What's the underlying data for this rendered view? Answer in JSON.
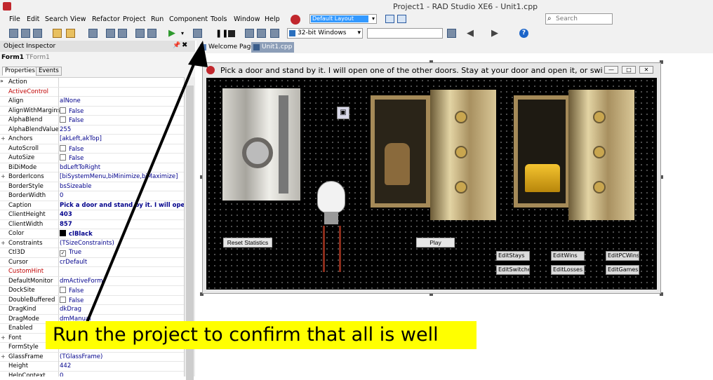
{
  "window": {
    "title": "Project1 - RAD Studio XE6 - Unit1.cpp"
  },
  "menu": [
    "File",
    "Edit",
    "Search",
    "View",
    "Refactor",
    "Project",
    "Run",
    "Component",
    "Tools",
    "Window",
    "Help"
  ],
  "layout_combo": {
    "value": "Default Layout"
  },
  "search": {
    "placeholder": "Search"
  },
  "toolbar": {
    "platform": "32-bit Windows",
    "configuration": ""
  },
  "object_inspector": {
    "title": "Object Inspector",
    "object_name": "Form1",
    "object_type": "TForm1",
    "tabs": [
      "Properties",
      "Events"
    ],
    "properties": [
      {
        "name": "Action",
        "value": "",
        "expand": "",
        "style": ""
      },
      {
        "name": "ActiveControl",
        "value": "",
        "expand": "",
        "style": "red"
      },
      {
        "name": "Align",
        "value": "alNone",
        "expand": "",
        "style": ""
      },
      {
        "name": "AlignWithMargins",
        "value": "False",
        "expand": "",
        "style": "",
        "checkbox": "unchecked"
      },
      {
        "name": "AlphaBlend",
        "value": "False",
        "expand": "",
        "style": "",
        "checkbox": "unchecked"
      },
      {
        "name": "AlphaBlendValue",
        "value": "255",
        "expand": "",
        "style": ""
      },
      {
        "name": "Anchors",
        "value": "[akLeft,akTop]",
        "expand": "+",
        "style": ""
      },
      {
        "name": "AutoScroll",
        "value": "False",
        "expand": "",
        "style": "",
        "checkbox": "unchecked"
      },
      {
        "name": "AutoSize",
        "value": "False",
        "expand": "",
        "style": "",
        "checkbox": "unchecked"
      },
      {
        "name": "BiDiMode",
        "value": "bdLeftToRight",
        "expand": "",
        "style": ""
      },
      {
        "name": "BorderIcons",
        "value": "[biSystemMenu,biMinimize,biMaximize]",
        "expand": "+",
        "style": ""
      },
      {
        "name": "BorderStyle",
        "value": "bsSizeable",
        "expand": "",
        "style": ""
      },
      {
        "name": "BorderWidth",
        "value": "0",
        "expand": "",
        "style": ""
      },
      {
        "name": "Caption",
        "value": "Pick a door and stand by it.  I will open one",
        "expand": "",
        "style": "bold"
      },
      {
        "name": "ClientHeight",
        "value": "403",
        "expand": "",
        "style": "bold"
      },
      {
        "name": "ClientWidth",
        "value": "857",
        "expand": "",
        "style": "bold"
      },
      {
        "name": "Color",
        "value": "clBlack",
        "expand": "",
        "style": "bold",
        "swatch": "#000000"
      },
      {
        "name": "Constraints",
        "value": "(TSizeConstraints)",
        "expand": "+",
        "style": ""
      },
      {
        "name": "Ctl3D",
        "value": "True",
        "expand": "",
        "style": "",
        "checkbox": "checked"
      },
      {
        "name": "Cursor",
        "value": "crDefault",
        "expand": "",
        "style": ""
      },
      {
        "name": "CustomHint",
        "value": "",
        "expand": "",
        "style": "red"
      },
      {
        "name": "DefaultMonitor",
        "value": "dmActiveForm",
        "expand": "",
        "style": ""
      },
      {
        "name": "DockSite",
        "value": "False",
        "expand": "",
        "style": "",
        "checkbox": "unchecked"
      },
      {
        "name": "DoubleBuffered",
        "value": "False",
        "expand": "",
        "style": "",
        "checkbox": "unchecked"
      },
      {
        "name": "DragKind",
        "value": "dkDrag",
        "expand": "",
        "style": ""
      },
      {
        "name": "DragMode",
        "value": "dmManual",
        "expand": "",
        "style": ""
      },
      {
        "name": "Enabled",
        "value": "",
        "expand": "",
        "style": ""
      },
      {
        "name": "Font",
        "value": "",
        "expand": "+",
        "style": ""
      },
      {
        "name": "FormStyle",
        "value": "fsNormal",
        "expand": "",
        "style": ""
      },
      {
        "name": "GlassFrame",
        "value": "(TGlassFrame)",
        "expand": "+",
        "style": ""
      },
      {
        "name": "Height",
        "value": "442",
        "expand": "",
        "style": ""
      },
      {
        "name": "HelpContext",
        "value": "0",
        "expand": "",
        "style": ""
      }
    ]
  },
  "editor_tabs": [
    "Welcome Page",
    "Unit1.cpp"
  ],
  "form": {
    "caption": "Pick a door and stand by it.  I will open one of the other doors.  Stay at your door and open it, or switch door...",
    "buttons": {
      "reset": "Reset Statistics",
      "play": "Play"
    },
    "edits": [
      "EditStays",
      "EditWins",
      "EditPCWins",
      "EditSwitches",
      "EditLosses",
      "EditGames"
    ]
  },
  "callout": {
    "text": "Run the project to confirm that all is well",
    "color": "#ffff00"
  },
  "icons": {
    "run": "run-icon",
    "save": "save-icon",
    "help": "help-icon"
  }
}
